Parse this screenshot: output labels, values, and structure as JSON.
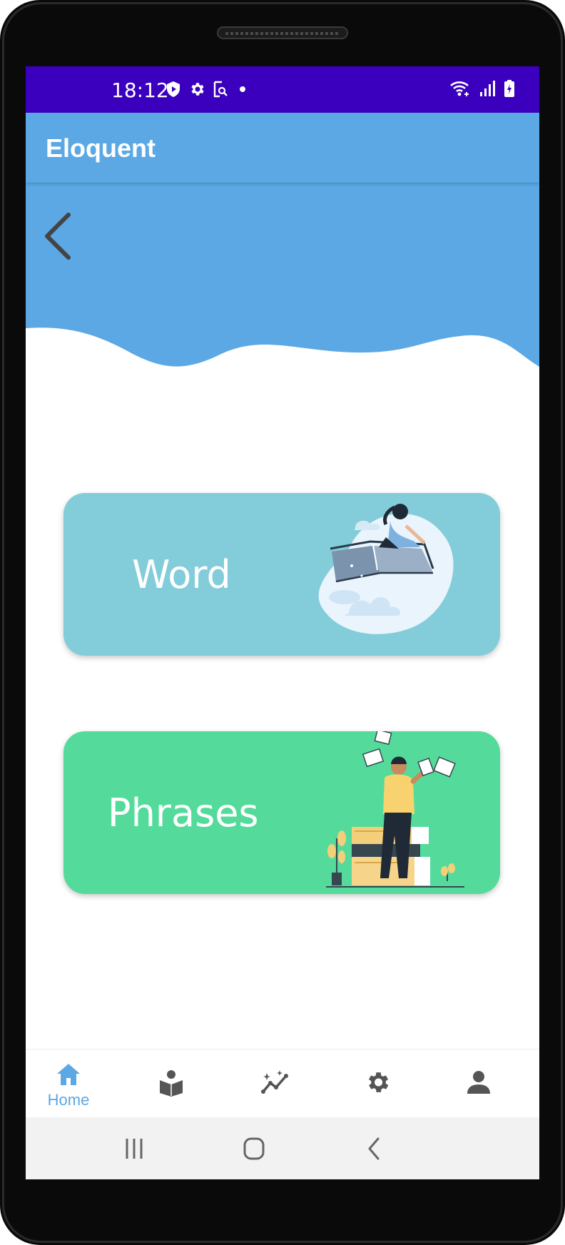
{
  "status_bar": {
    "time": "18:12",
    "background": "#3a00bd",
    "left_icons": [
      "shield-icon",
      "gear-icon",
      "screen-search-icon",
      "dot-icon"
    ],
    "right_icons": [
      "wifi-icon",
      "signal-icon",
      "battery-charging-icon"
    ]
  },
  "app_bar": {
    "title": "Eloquent",
    "background": "#5ba8e4"
  },
  "header": {
    "back_icon": "chevron-left-icon"
  },
  "cards": [
    {
      "label": "Word",
      "color": "#82cdd9",
      "illustration": "reading-on-flying-book-illustration"
    },
    {
      "label": "Phrases",
      "color": "#54db9b",
      "illustration": "person-reading-with-book-stack-illustration"
    }
  ],
  "bottom_nav": {
    "accent": "#5ba8e4",
    "items": [
      {
        "label": "Home",
        "icon": "home-icon",
        "active": true
      },
      {
        "label": "",
        "icon": "reader-book-icon",
        "active": false
      },
      {
        "label": "",
        "icon": "progress-chart-icon",
        "active": false
      },
      {
        "label": "",
        "icon": "gear-icon",
        "active": false
      },
      {
        "label": "",
        "icon": "person-icon",
        "active": false
      }
    ]
  },
  "system_nav": {
    "buttons": [
      "recents-icon",
      "home-circle-icon",
      "back-chevron-icon"
    ]
  }
}
